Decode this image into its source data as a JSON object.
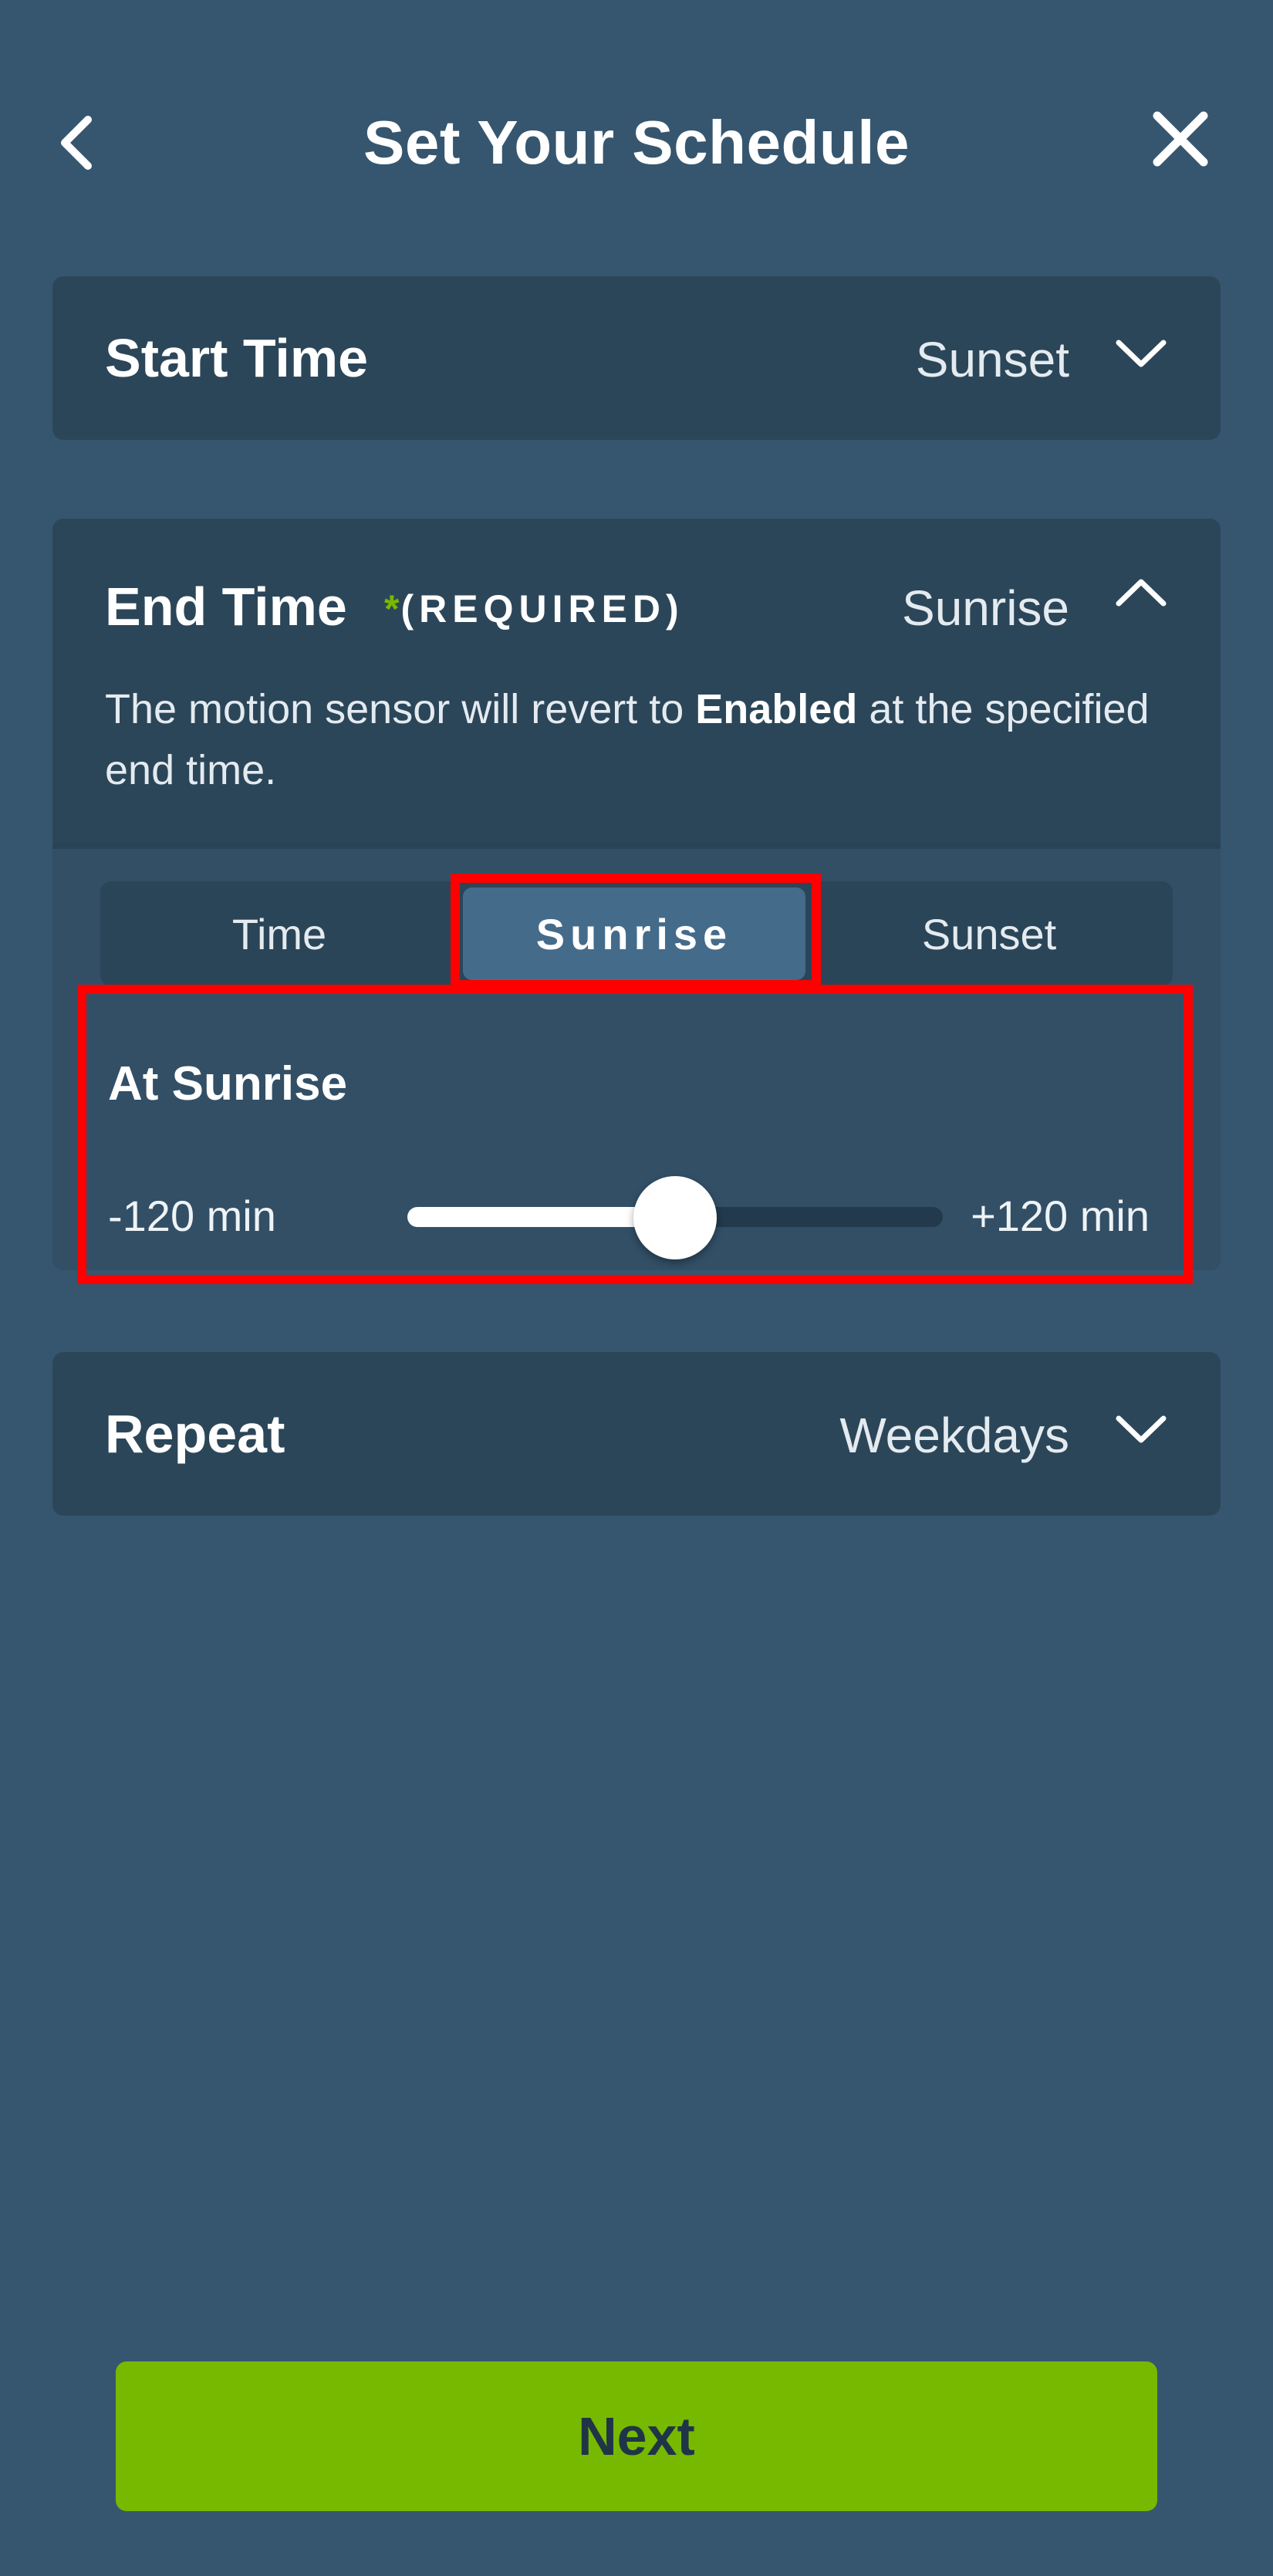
{
  "header": {
    "title": "Set Your Schedule",
    "back_icon": "chevron-left-icon",
    "close_icon": "close-icon"
  },
  "start_time": {
    "title": "Start Time",
    "value": "Sunset",
    "expanded": false
  },
  "end_time": {
    "title": "End Time",
    "required_star": "*",
    "required_label": "(REQUIRED)",
    "value": "Sunrise",
    "expanded": true,
    "description_before": "The motion sensor will revert to ",
    "description_bold": "Enabled",
    "description_after": " at the specified end time.",
    "tabs": [
      {
        "label": "Time",
        "selected": false
      },
      {
        "label": "Sunrise",
        "selected": true
      },
      {
        "label": "Sunset",
        "selected": false
      }
    ],
    "offset_heading": "At Sunrise",
    "slider": {
      "min_label": "-120 min",
      "max_label": "+120 min",
      "min": -120,
      "max": 120,
      "value": 0
    }
  },
  "repeat": {
    "title": "Repeat",
    "value": "Weekdays",
    "expanded": false
  },
  "footer": {
    "next_label": "Next"
  },
  "colors": {
    "background": "#36566f",
    "card": "#2c4659",
    "selected_tab": "#456b8b",
    "accent": "#76b900",
    "highlight": "#ff0000"
  }
}
